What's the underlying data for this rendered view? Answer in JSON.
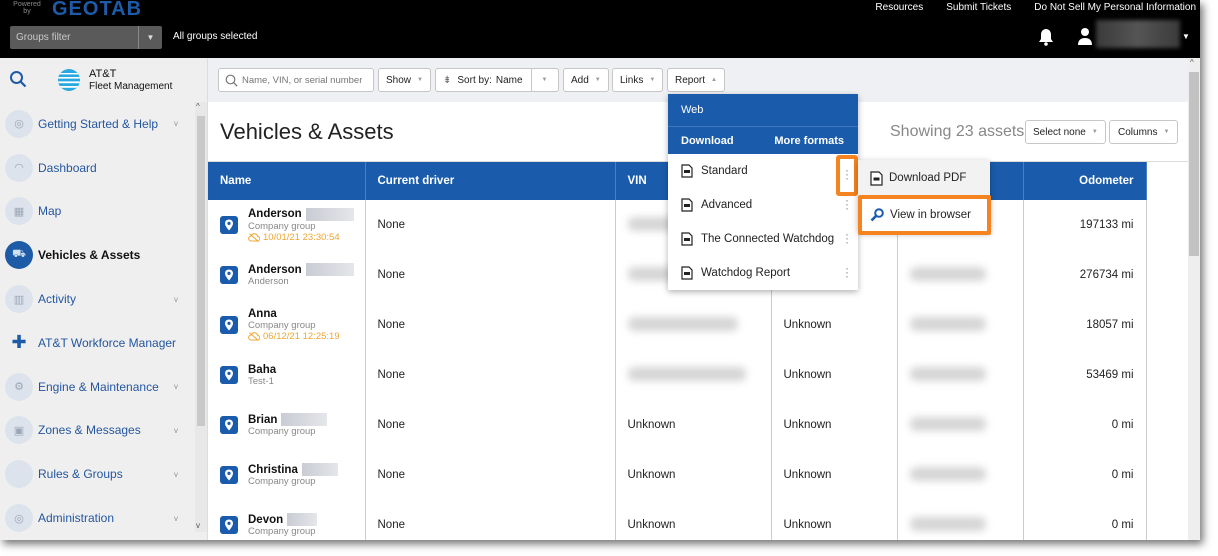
{
  "topbar": {
    "powered_by": "Powered by",
    "brand": "GEOTAB",
    "groups_filter_placeholder": "Groups filter",
    "groups_status": "All groups selected",
    "links": [
      "Resources",
      "Submit Tickets",
      "Do Not Sell My Personal Information"
    ]
  },
  "sidebar": {
    "logo_line1": "AT&T",
    "logo_line2": "Fleet Management",
    "items": [
      {
        "label": "Getting Started & Help",
        "icon": "camera-icon",
        "glyph": "◎",
        "expandable": true,
        "active": false
      },
      {
        "label": "Dashboard",
        "icon": "gauge-icon",
        "glyph": "◠",
        "expandable": false,
        "active": false
      },
      {
        "label": "Map",
        "icon": "map-icon",
        "glyph": "▦",
        "expandable": false,
        "active": false
      },
      {
        "label": "Vehicles & Assets",
        "icon": "truck-icon",
        "glyph": "⛟",
        "expandable": false,
        "active": true
      },
      {
        "label": "Activity",
        "icon": "chart-icon",
        "glyph": "▥",
        "expandable": true,
        "active": false
      },
      {
        "label": "AT&T Workforce Manager",
        "icon": "puzzle-icon",
        "glyph": "✚",
        "expandable": false,
        "active": false
      },
      {
        "label": "Engine & Maintenance",
        "icon": "engine-icon",
        "glyph": "⚙",
        "expandable": true,
        "active": false
      },
      {
        "label": "Zones & Messages",
        "icon": "zone-icon",
        "glyph": "▣",
        "expandable": true,
        "active": false
      },
      {
        "label": "Rules & Groups",
        "icon": "rules-icon",
        "glyph": "",
        "expandable": true,
        "active": false
      },
      {
        "label": "Administration",
        "icon": "admin-icon",
        "glyph": "◎",
        "expandable": true,
        "active": false
      }
    ]
  },
  "toolbar": {
    "search_placeholder": "Name, VIN, or serial number",
    "show": "Show",
    "sort_by_label": "Sort by:",
    "sort_by_value": "Name",
    "add": "Add",
    "links": "Links",
    "report": "Report"
  },
  "page": {
    "title": "Vehicles & Assets",
    "showing": "Showing 23 assets",
    "select_none": "Select none",
    "columns": "Columns"
  },
  "table": {
    "headers": [
      "Name",
      "Current driver",
      "VIN",
      "",
      "",
      "Odometer"
    ],
    "rows": [
      {
        "name": "Anderson",
        "group": "Company group",
        "stamp": "10/01/21 23:30:54",
        "driver": "None",
        "vin": "",
        "col4": "",
        "odometer": "197133 mi"
      },
      {
        "name": "Anderson",
        "group": "Anderson",
        "stamp": "",
        "driver": "None",
        "vin": "",
        "col4": "",
        "odometer": "276734 mi"
      },
      {
        "name": "Anna",
        "group": "Company group",
        "stamp": "06/12/21 12:25:19",
        "driver": "None",
        "vin": "",
        "col4": "Unknown",
        "odometer": "18057 mi"
      },
      {
        "name": "Baha",
        "group": "Test-1",
        "stamp": "",
        "driver": "None",
        "vin": "",
        "col4": "Unknown",
        "odometer": "53469 mi"
      },
      {
        "name": "Brian",
        "group": "Company group",
        "stamp": "",
        "driver": "None",
        "vin": "Unknown",
        "col4": "Unknown",
        "odometer": "0 mi"
      },
      {
        "name": "Christina",
        "group": "Company group",
        "stamp": "",
        "driver": "None",
        "vin": "Unknown",
        "col4": "Unknown",
        "odometer": "0 mi"
      },
      {
        "name": "Devon",
        "group": "Company group",
        "stamp": "",
        "driver": "None",
        "vin": "Unknown",
        "col4": "Unknown",
        "odometer": "0 mi"
      }
    ]
  },
  "report_menu": {
    "web": "Web",
    "download": "Download",
    "more_formats": "More formats",
    "items": [
      "Standard",
      "Advanced",
      "The Connected Watchdog",
      "Watchdog Report"
    ]
  },
  "sub_menu": {
    "download_pdf": "Download PDF",
    "view_in_browser": "View in browser"
  },
  "colors": {
    "brand_blue": "#1a5cab",
    "highlight_orange": "#f5831f",
    "offline_amber": "#f0a531"
  }
}
